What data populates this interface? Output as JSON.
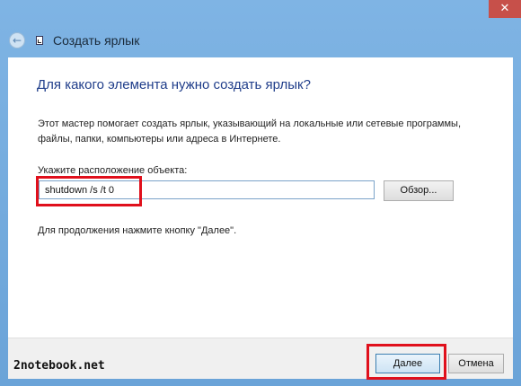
{
  "window": {
    "title": "Создать ярлык",
    "close_symbol": "✕",
    "back_symbol": "←",
    "accent_color": "#6aa3d8"
  },
  "wizard": {
    "heading": "Для какого элемента нужно создать ярлык?",
    "description": "Этот мастер помогает создать ярлык, указывающий на локальные или сетевые программы, файлы, папки, компьютеры или адреса в Интернете.",
    "field_label": "Укажите расположение объекта:",
    "path_value": "shutdown /s /t 0",
    "browse_label": "Обзор...",
    "hint": "Для продолжения нажмите кнопку \"Далее\"."
  },
  "footer": {
    "watermark": "2notebook.net",
    "next_label": "Далее",
    "cancel_label": "Отмена"
  },
  "annotations": {
    "highlight_color": "#e0101c"
  }
}
